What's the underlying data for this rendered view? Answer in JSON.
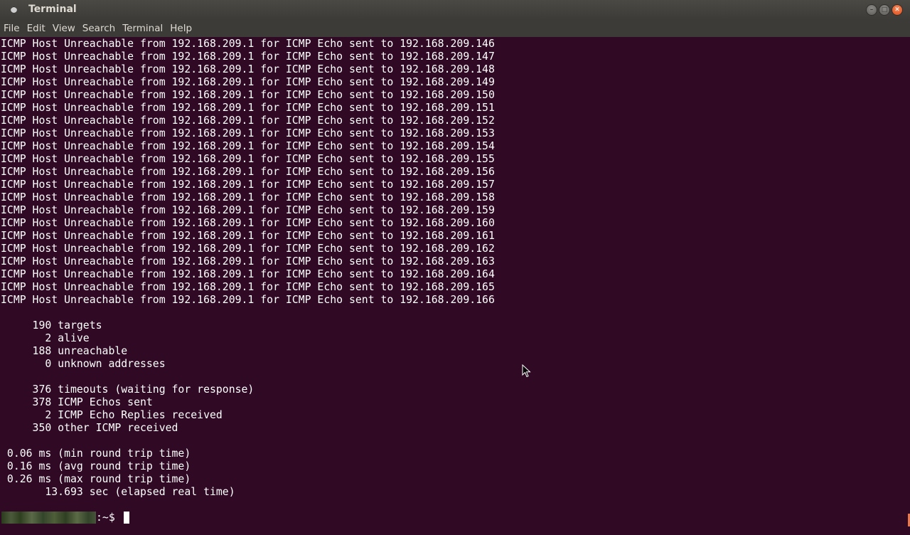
{
  "window": {
    "title": "Terminal",
    "controls": {
      "minimize_icon": "minimize-icon",
      "maximize_icon": "maximize-icon",
      "close_icon": "close-icon"
    }
  },
  "menu": [
    "File",
    "Edit",
    "View",
    "Search",
    "Terminal",
    "Help"
  ],
  "terminal": {
    "lines": [
      "ICMP Host Unreachable from 192.168.209.1 for ICMP Echo sent to 192.168.209.146",
      "ICMP Host Unreachable from 192.168.209.1 for ICMP Echo sent to 192.168.209.147",
      "ICMP Host Unreachable from 192.168.209.1 for ICMP Echo sent to 192.168.209.148",
      "ICMP Host Unreachable from 192.168.209.1 for ICMP Echo sent to 192.168.209.149",
      "ICMP Host Unreachable from 192.168.209.1 for ICMP Echo sent to 192.168.209.150",
      "ICMP Host Unreachable from 192.168.209.1 for ICMP Echo sent to 192.168.209.151",
      "ICMP Host Unreachable from 192.168.209.1 for ICMP Echo sent to 192.168.209.152",
      "ICMP Host Unreachable from 192.168.209.1 for ICMP Echo sent to 192.168.209.153",
      "ICMP Host Unreachable from 192.168.209.1 for ICMP Echo sent to 192.168.209.154",
      "ICMP Host Unreachable from 192.168.209.1 for ICMP Echo sent to 192.168.209.155",
      "ICMP Host Unreachable from 192.168.209.1 for ICMP Echo sent to 192.168.209.156",
      "ICMP Host Unreachable from 192.168.209.1 for ICMP Echo sent to 192.168.209.157",
      "ICMP Host Unreachable from 192.168.209.1 for ICMP Echo sent to 192.168.209.158",
      "ICMP Host Unreachable from 192.168.209.1 for ICMP Echo sent to 192.168.209.159",
      "ICMP Host Unreachable from 192.168.209.1 for ICMP Echo sent to 192.168.209.160",
      "ICMP Host Unreachable from 192.168.209.1 for ICMP Echo sent to 192.168.209.161",
      "ICMP Host Unreachable from 192.168.209.1 for ICMP Echo sent to 192.168.209.162",
      "ICMP Host Unreachable from 192.168.209.1 for ICMP Echo sent to 192.168.209.163",
      "ICMP Host Unreachable from 192.168.209.1 for ICMP Echo sent to 192.168.209.164",
      "ICMP Host Unreachable from 192.168.209.1 for ICMP Echo sent to 192.168.209.165",
      "ICMP Host Unreachable from 192.168.209.1 for ICMP Echo sent to 192.168.209.166",
      "",
      "     190 targets",
      "       2 alive",
      "     188 unreachable",
      "       0 unknown addresses",
      "",
      "     376 timeouts (waiting for response)",
      "     378 ICMP Echos sent",
      "       2 ICMP Echo Replies received",
      "     350 other ICMP received",
      "",
      " 0.06 ms (min round trip time)",
      " 0.16 ms (avg round trip time)",
      " 0.26 ms (max round trip time)",
      "       13.693 sec (elapsed real time)"
    ],
    "prompt_suffix": ":~$ "
  },
  "colors": {
    "background": "#300a24",
    "text": "#ffffff",
    "titlebar": "#3c3b37",
    "close_button": "#df4a16"
  },
  "pointer_icon": "mouse-pointer-icon"
}
